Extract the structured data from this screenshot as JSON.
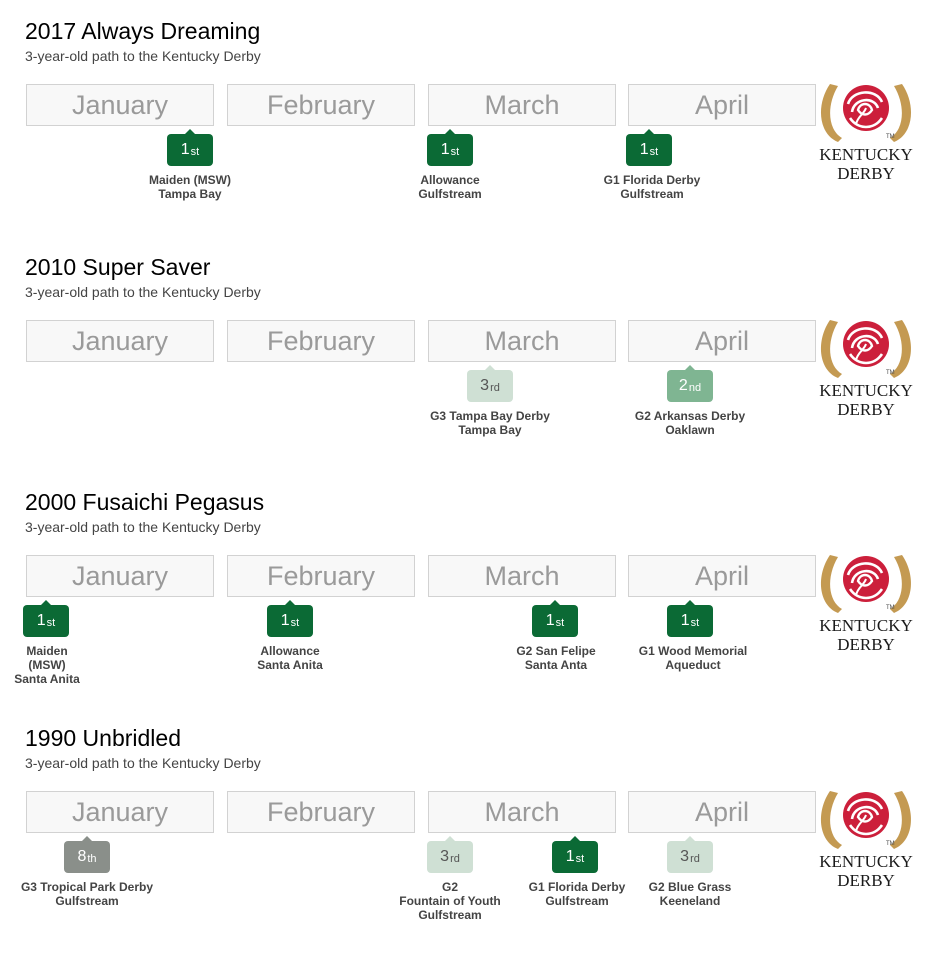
{
  "sections": [
    {
      "title": "2017 Always Dreaming",
      "subtitle": "3-year-old path to the Kentucky Derby",
      "months": [
        "January",
        "February",
        "March",
        "April"
      ],
      "races": [
        {
          "place": "1",
          "suffix": "st",
          "status": "win",
          "lines": [
            "Maiden (MSW)",
            "Tampa Bay"
          ]
        },
        {
          "place": "1",
          "suffix": "st",
          "status": "win",
          "lines": [
            "Allowance",
            "Gulfstream"
          ]
        },
        {
          "place": "1",
          "suffix": "st",
          "status": "win",
          "lines": [
            "G1 Florida Derby",
            "Gulfstream"
          ]
        }
      ]
    },
    {
      "title": "2010 Super Saver",
      "subtitle": "3-year-old path to the Kentucky Derby",
      "months": [
        "January",
        "February",
        "March",
        "April"
      ],
      "races": [
        {
          "place": "3",
          "suffix": "rd",
          "status": "third",
          "lines": [
            "G3 Tampa Bay Derby",
            "Tampa Bay"
          ]
        },
        {
          "place": "2",
          "suffix": "nd",
          "status": "second",
          "lines": [
            "G2 Arkansas Derby",
            "Oaklawn"
          ]
        }
      ]
    },
    {
      "title": "2000 Fusaichi Pegasus",
      "subtitle": "3-year-old path to the Kentucky Derby",
      "months": [
        "January",
        "February",
        "March",
        "April"
      ],
      "races": [
        {
          "place": "1",
          "suffix": "st",
          "status": "win",
          "lines": [
            "Maiden",
            "(MSW)",
            "Santa Anita"
          ]
        },
        {
          "place": "1",
          "suffix": "st",
          "status": "win",
          "lines": [
            "Allowance",
            "Santa Anita"
          ]
        },
        {
          "place": "1",
          "suffix": "st",
          "status": "win",
          "lines": [
            "G2 San Felipe",
            "Santa Anta"
          ]
        },
        {
          "place": "1",
          "suffix": "st",
          "status": "win",
          "lines": [
            "G1 Wood Memorial",
            "Aqueduct"
          ]
        }
      ]
    },
    {
      "title": "1990 Unbridled",
      "subtitle": "3-year-old path to the Kentucky Derby",
      "months": [
        "January",
        "February",
        "March",
        "April"
      ],
      "races": [
        {
          "place": "8",
          "suffix": "th",
          "status": "unplaced",
          "lines": [
            "G3 Tropical Park Derby",
            "Gulfstream"
          ]
        },
        {
          "place": "3",
          "suffix": "rd",
          "status": "third",
          "lines": [
            "G2",
            "Fountain of Youth",
            "Gulfstream"
          ]
        },
        {
          "place": "1",
          "suffix": "st",
          "status": "win",
          "lines": [
            "G1 Florida Derby",
            "Gulfstream"
          ]
        },
        {
          "place": "3",
          "suffix": "rd",
          "status": "third",
          "lines": [
            "G2 Blue Grass",
            "Keeneland"
          ]
        }
      ]
    }
  ],
  "logo": {
    "line1": "KENTUCKY",
    "line2": "DERBY",
    "mark": "TM"
  },
  "colors": {
    "win": "#0b6a35",
    "second": "#7fb592",
    "third": "#cfe0d4",
    "unplaced": "#8a8f8a",
    "month_text": "#9a9a9a",
    "horseshoe": "#c49a52",
    "rose": "#cc1f3b"
  }
}
